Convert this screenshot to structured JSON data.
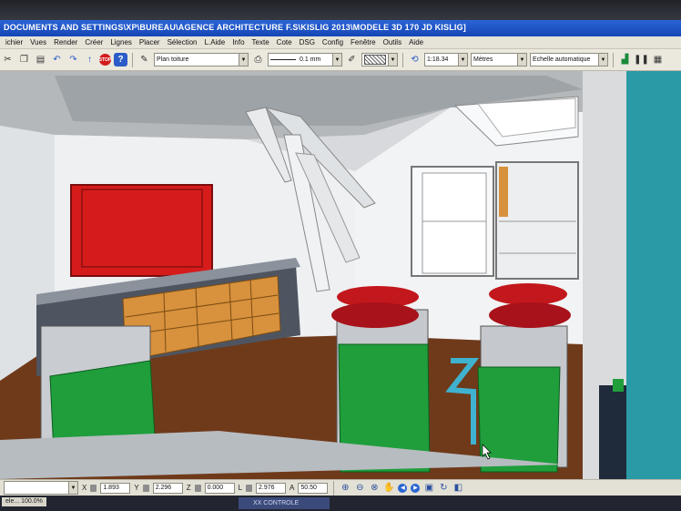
{
  "window": {
    "title": "DOCUMENTS AND SETTINGS\\XP\\BUREAU\\AGENCE ARCHITECTURE F.S\\KISLIG 2013\\MODELE 3D 170 JD KISLIG]"
  },
  "menu": {
    "items": [
      "ichier",
      "Vues",
      "Render",
      "Créer",
      "Lignes",
      "Placer",
      "Sélection",
      "L.Aide",
      "Info",
      "Texte",
      "Cote",
      "DSG",
      "Config",
      "Fenêtre",
      "Outils",
      "Aide"
    ]
  },
  "toolbar": {
    "layer": "Plan toiture",
    "line_width": "0.1 mm",
    "scale": "1:18.34",
    "units": "Mètres",
    "scale_mode": "Echelle automatique",
    "icons": [
      "cut-icon",
      "copy-icon",
      "paste-icon",
      "undo-icon",
      "redo-icon",
      "up-arrow-icon",
      "stop-icon",
      "help-icon",
      "brush-icon"
    ]
  },
  "statusbar": {
    "x_label": "X",
    "x_value": "1.893",
    "y_label": "Y",
    "y_value": "2.296",
    "z_label": "Z",
    "z_value": "0.000",
    "l_label": "L",
    "l_value": "2.976",
    "a_label": "A",
    "a_value": "50.50",
    "zoom": "ele... 100.0%",
    "task_button": "XX CONTROLE"
  },
  "colors": {
    "title_blue": "#1e55c8",
    "cabinet_orange": "#d8913c",
    "chair_green": "#1f9e3b",
    "chair_red": "#c2171c",
    "panel_red": "#d61b1b",
    "door_cyan": "#2a9aa6"
  }
}
